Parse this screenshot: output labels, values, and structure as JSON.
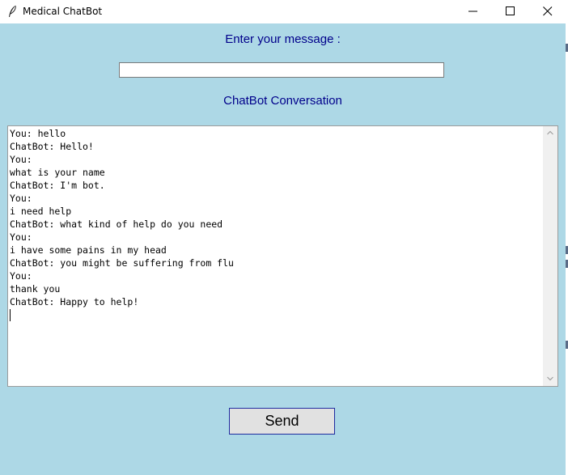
{
  "window": {
    "title": "Medical ChatBot",
    "icon": "feather-icon",
    "controls": [
      "minimize-icon",
      "maximize-icon",
      "close-icon"
    ]
  },
  "form": {
    "enter_label": "Enter your message :",
    "message_value": "",
    "conversation_label": "ChatBot Conversation",
    "send_label": "Send"
  },
  "conversation": {
    "lines": [
      "You: hello",
      "ChatBot: Hello!",
      "You:",
      "what is your name",
      "ChatBot: I'm bot.",
      "You:",
      "i need help",
      "ChatBot: what kind of help do you need",
      "You:",
      "i have some pains in my head",
      "ChatBot: you might be suffering from flu",
      "You:",
      "thank you",
      "ChatBot: Happy to help!"
    ]
  },
  "colors": {
    "background": "#add8e6",
    "label_text": "#00008b",
    "button_face": "#e1e1e1",
    "button_border": "#1e2b9f"
  }
}
